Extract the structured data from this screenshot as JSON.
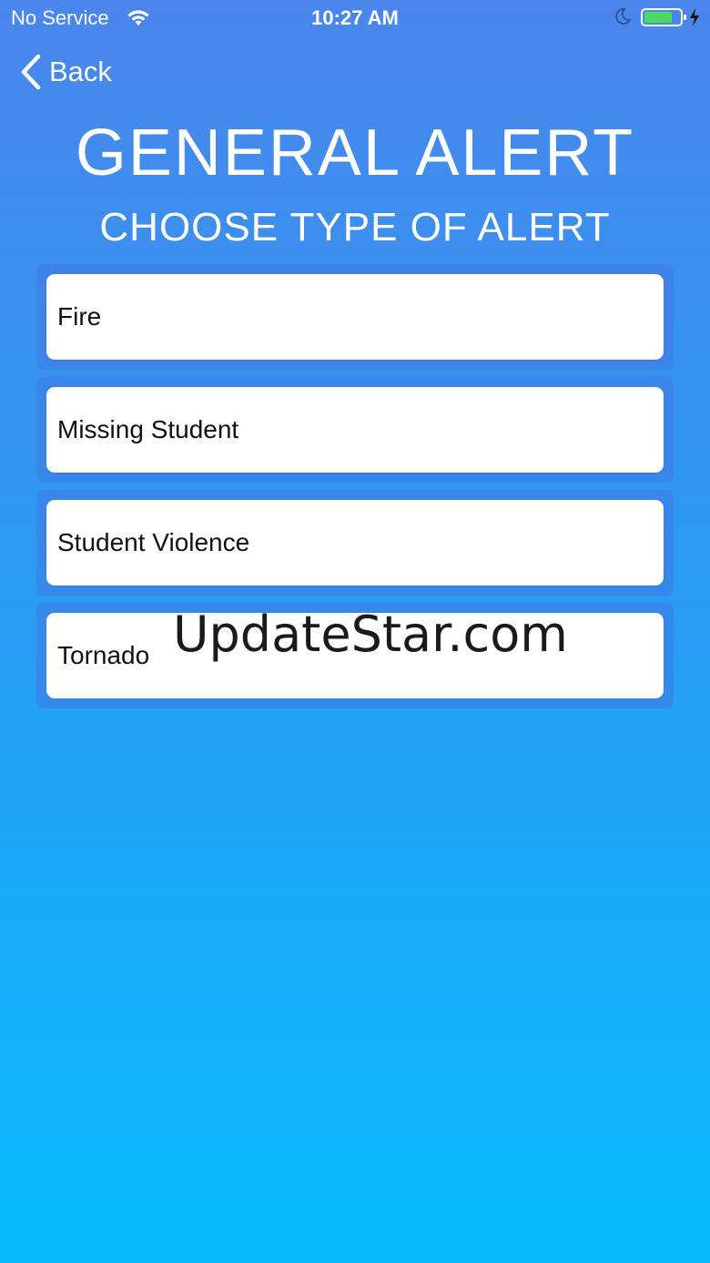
{
  "status_bar": {
    "carrier": "No Service",
    "time": "10:27 AM",
    "wifi_icon": "wifi-icon",
    "moon_icon": "moon-icon",
    "battery_icon": "battery-charging-icon",
    "battery_level": 0.75,
    "battery_color": "#4cd964"
  },
  "nav": {
    "back_label": "Back",
    "back_icon": "chevron-left-icon"
  },
  "header": {
    "title": "GENERAL ALERT",
    "subtitle": "CHOOSE TYPE OF ALERT"
  },
  "alerts": {
    "items": [
      {
        "label": "Fire"
      },
      {
        "label": "Missing Student"
      },
      {
        "label": "Student Violence"
      },
      {
        "label": "Tornado"
      }
    ]
  },
  "watermark": {
    "text": "UpdateStar.com"
  },
  "colors": {
    "gradient_top": "#4a86ec",
    "gradient_bottom": "#07bcfb",
    "card_background": "#ffffff"
  }
}
